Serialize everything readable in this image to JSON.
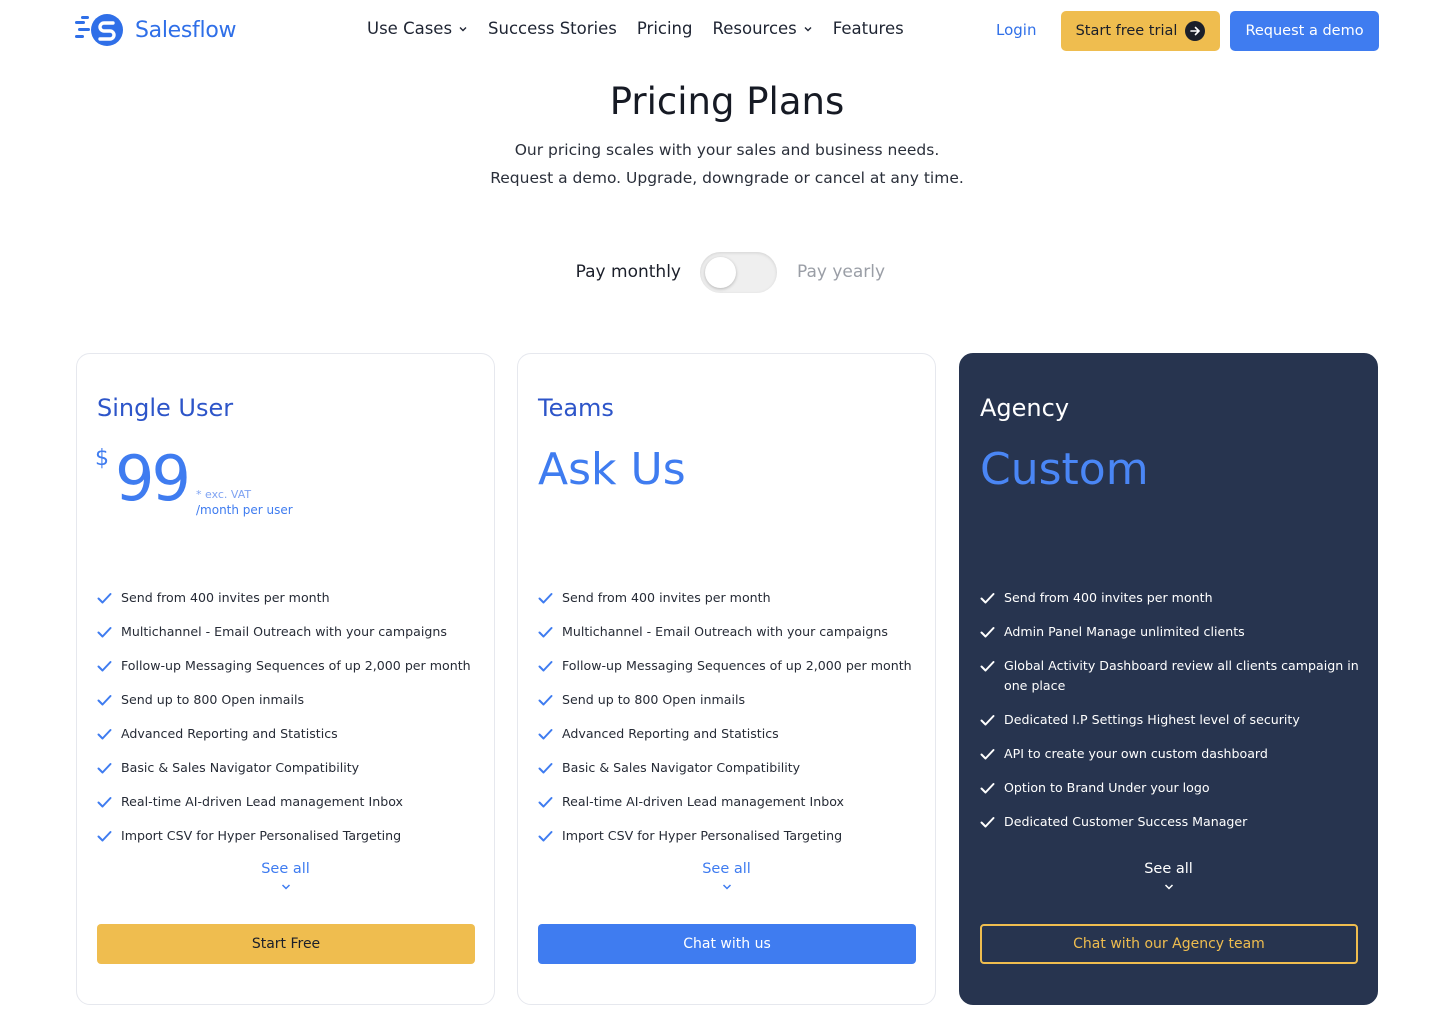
{
  "header": {
    "brand": "Salesflow",
    "nav": [
      {
        "label": "Use Cases",
        "has_dropdown": true
      },
      {
        "label": "Success Stories",
        "has_dropdown": false
      },
      {
        "label": "Pricing",
        "has_dropdown": false
      },
      {
        "label": "Resources",
        "has_dropdown": true
      },
      {
        "label": "Features",
        "has_dropdown": false
      }
    ],
    "login": "Login",
    "trial_button": "Start free trial",
    "demo_button": "Request a demo"
  },
  "hero": {
    "title": "Pricing Plans",
    "subtitle_line1": "Our pricing scales with your sales and business needs.",
    "subtitle_line2": "Request a demo. Upgrade, downgrade or cancel at any time."
  },
  "billing": {
    "monthly_label": "Pay monthly",
    "yearly_label": "Pay yearly",
    "yearly_selected": false
  },
  "plans": {
    "single": {
      "name": "Single User",
      "currency": "$",
      "price": "99",
      "vat_note": "* exc. VAT",
      "period": "/month per user",
      "features": [
        "Send from 400 invites per month",
        "Multichannel - Email Outreach with your campaigns",
        "Follow-up Messaging Sequences of up 2,000 per month",
        "Send up to 800 Open inmails",
        "Advanced Reporting and Statistics",
        "Basic & Sales Navigator Compatibility",
        "Real-time AI-driven Lead management Inbox",
        "Import CSV for Hyper Personalised Targeting"
      ],
      "see_all": "See all",
      "cta": "Start Free"
    },
    "teams": {
      "name": "Teams",
      "price_text": "Ask Us",
      "features": [
        "Send from 400 invites per month",
        "Multichannel - Email Outreach with your campaigns",
        "Follow-up Messaging Sequences of up 2,000 per month",
        "Send up to 800 Open inmails",
        "Advanced Reporting and Statistics",
        "Basic & Sales Navigator Compatibility",
        "Real-time AI-driven Lead management Inbox",
        "Import CSV for Hyper Personalised Targeting"
      ],
      "see_all": "See all",
      "cta": "Chat with us"
    },
    "agency": {
      "name": "Agency",
      "price_text": "Custom",
      "features": [
        "Send from 400 invites per month",
        "Admin Panel Manage unlimited clients",
        "Global Activity Dashboard review all clients campaign in one place",
        "Dedicated I.P Settings Highest level of security",
        "API to create your own custom dashboard",
        "Option to Brand Under your logo",
        "Dedicated Customer Success Manager"
      ],
      "see_all": "See all",
      "cta": "Chat with our Agency team"
    }
  },
  "colors": {
    "brand_blue": "#3f7cf0",
    "accent_yellow": "#efbd4f",
    "agency_card_bg": "#27344f"
  },
  "icons": [
    "salesflow-logo-icon",
    "chevron-down-icon",
    "arrow-right-icon",
    "check-icon"
  ]
}
